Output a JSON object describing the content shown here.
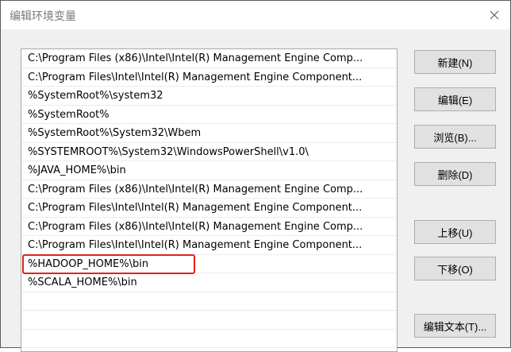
{
  "window": {
    "title": "编辑环境变量"
  },
  "path_list": [
    "C:\\Program Files (x86)\\Intel\\Intel(R) Management Engine Comp...",
    "C:\\Program Files\\Intel\\Intel(R) Management Engine Component...",
    "%SystemRoot%\\system32",
    "%SystemRoot%",
    "%SystemRoot%\\System32\\Wbem",
    "%SYSTEMROOT%\\System32\\WindowsPowerShell\\v1.0\\",
    "%JAVA_HOME%\\bin",
    "C:\\Program Files (x86)\\Intel\\Intel(R) Management Engine Comp...",
    "C:\\Program Files\\Intel\\Intel(R) Management Engine Component...",
    "C:\\Program Files (x86)\\Intel\\Intel(R) Management Engine Comp...",
    "C:\\Program Files\\Intel\\Intel(R) Management Engine Component...",
    "%HADOOP_HOME%\\bin",
    "%SCALA_HOME%\\bin"
  ],
  "buttons": {
    "new": "新建(N)",
    "edit": "编辑(E)",
    "browse": "浏览(B)...",
    "delete": "删除(D)",
    "move_up": "上移(U)",
    "move_down": "下移(O)",
    "edit_text": "编辑文本(T)..."
  },
  "colors": {
    "annotation": "#e0231a",
    "button_face": "#e1e1e1",
    "dialog_bg": "#f0f0f0"
  }
}
